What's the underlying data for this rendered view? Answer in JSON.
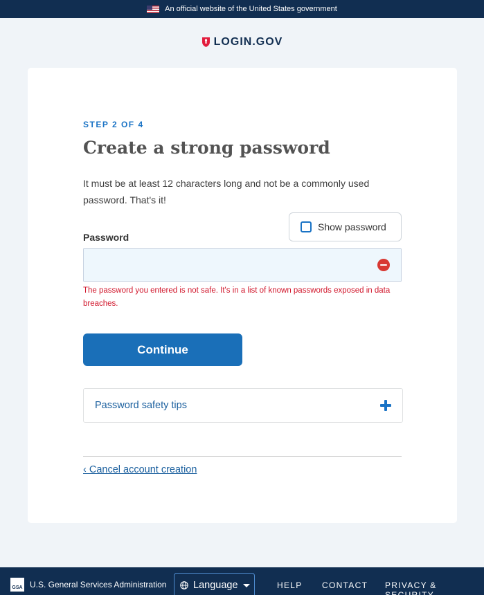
{
  "banner": {
    "text": "An official website of the United States government"
  },
  "brand": {
    "name": "LOGIN.GOV"
  },
  "form": {
    "step": "STEP 2 OF 4",
    "title": "Create a strong password",
    "description": "It must be at least 12 characters long and not be a commonly used password. That's it!",
    "show_password_label": "Show password",
    "password_label": "Password",
    "password_value": "",
    "error_message": "The password you entered is not safe. It's in a list of known passwords exposed in data breaches.",
    "continue_label": "Continue",
    "tips_label": "Password safety tips",
    "cancel_label": "‹ Cancel account creation"
  },
  "footer": {
    "gsa_logo_text": "GSA",
    "agency": "U.S. General Services Administration",
    "language_label": "Language",
    "links": [
      "HELP",
      "CONTACT",
      "PRIVACY & SECURITY"
    ]
  },
  "colors": {
    "primary": "#1a6fb8",
    "navy": "#112e51",
    "error": "#d83933"
  }
}
